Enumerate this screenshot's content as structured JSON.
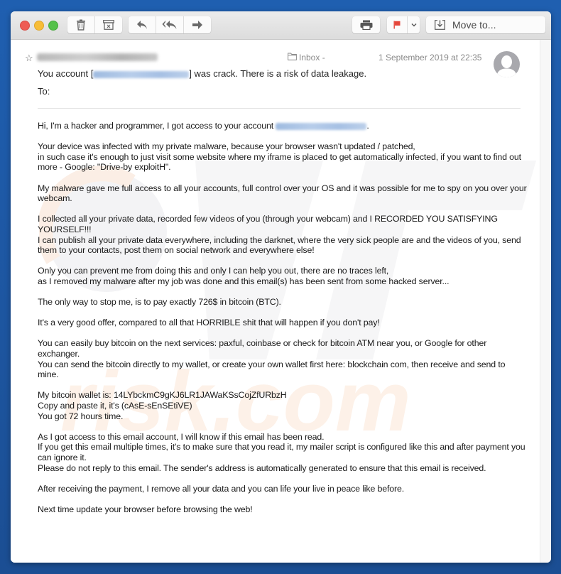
{
  "toolbar": {
    "buttons": [
      {
        "name": "delete",
        "icon": "trash-icon"
      },
      {
        "name": "archive",
        "icon": "archive-icon"
      },
      {
        "name": "reply",
        "icon": "reply-icon"
      },
      {
        "name": "reply-all",
        "icon": "reply-all-icon"
      },
      {
        "name": "forward",
        "icon": "forward-icon"
      },
      {
        "name": "print",
        "icon": "printer-icon"
      },
      {
        "name": "flag",
        "icon": "flag-icon",
        "color": "#e5463b"
      },
      {
        "name": "flag-menu",
        "icon": "chevron-down-icon"
      }
    ],
    "move_to_label": "Move to..."
  },
  "window_controls": {
    "close_color": "#ee5c54",
    "minimize_color": "#f7bd37",
    "zoom_color": "#55c14a"
  },
  "message": {
    "sender_redacted": true,
    "folder": "Inbox -",
    "date": "1 September 2019 at 22:35",
    "subject_prefix": "You account [",
    "subject_suffix": "] was crack. There is a risk of data leakage.",
    "to_label": "To:",
    "body": {
      "greeting_prefix": "Hi, I'm a hacker and programmer, I got access to your account",
      "greeting_suffix": ".",
      "p1": [
        "Your device was infected with my private malware, because your browser wasn't updated / patched,",
        "in such case it's enough to just visit some website where my iframe is placed to get automatically infected, if you want to find out more - Google: \"Drive-by exploitH\"."
      ],
      "p2": "My malware gave me full access to all your accounts, full control over your OS and it was possible for me to spy on you over your webcam.",
      "p3": [
        "I collected all your private data, recorded few videos of you (through your webcam) and I RECORDED YOU SATISFYING YOURSELF!!!",
        "I can publish all your private data everywhere, including the darknet, where the very sick people are and the videos of you, send them to your contacts, post them on social network and everywhere else!"
      ],
      "p4": [
        "Only you can prevent me from doing this and only I can help you out, there are no traces left,",
        "as I removed my malware after my job was done and this email(s) has been sent from some hacked server..."
      ],
      "p5": "The only way to stop me, is to pay exactly 726$ in bitcoin (BTC).",
      "p6": "It's a very good offer, compared to all that HORRIBLE shit that will happen if you don't pay!",
      "p7": [
        "You can easily buy bitcoin on the next services: paxful, coinbase or check for bitcoin ATM near you, or Google for other exchanger.",
        "You can send the bitcoin directly to my wallet, or create your own wallet first here: blockchain com, then receive and send to mine."
      ],
      "p8": [
        "My bitcoin wallet is: 14LYbckmC9gKJ6LR1JAWaKSsCojZfURbzH",
        "Copy and paste it, it's (cAsE-sEnSEtiVE)",
        "You got 72 hours time."
      ],
      "p9": [
        "As I got access to this email account, I will know if this email has been read.",
        "If you get this email multiple times, it's to make sure that you read it, my mailer script is configured like this and after payment you can ignore it.",
        "Please do not reply to this email. The sender's address is automatically generated to ensure that this email is received."
      ],
      "p10": "After receiving the payment, I remove all your data and you can life your live in peace like before.",
      "p11": "Next time update your browser before browsing the web!"
    }
  }
}
